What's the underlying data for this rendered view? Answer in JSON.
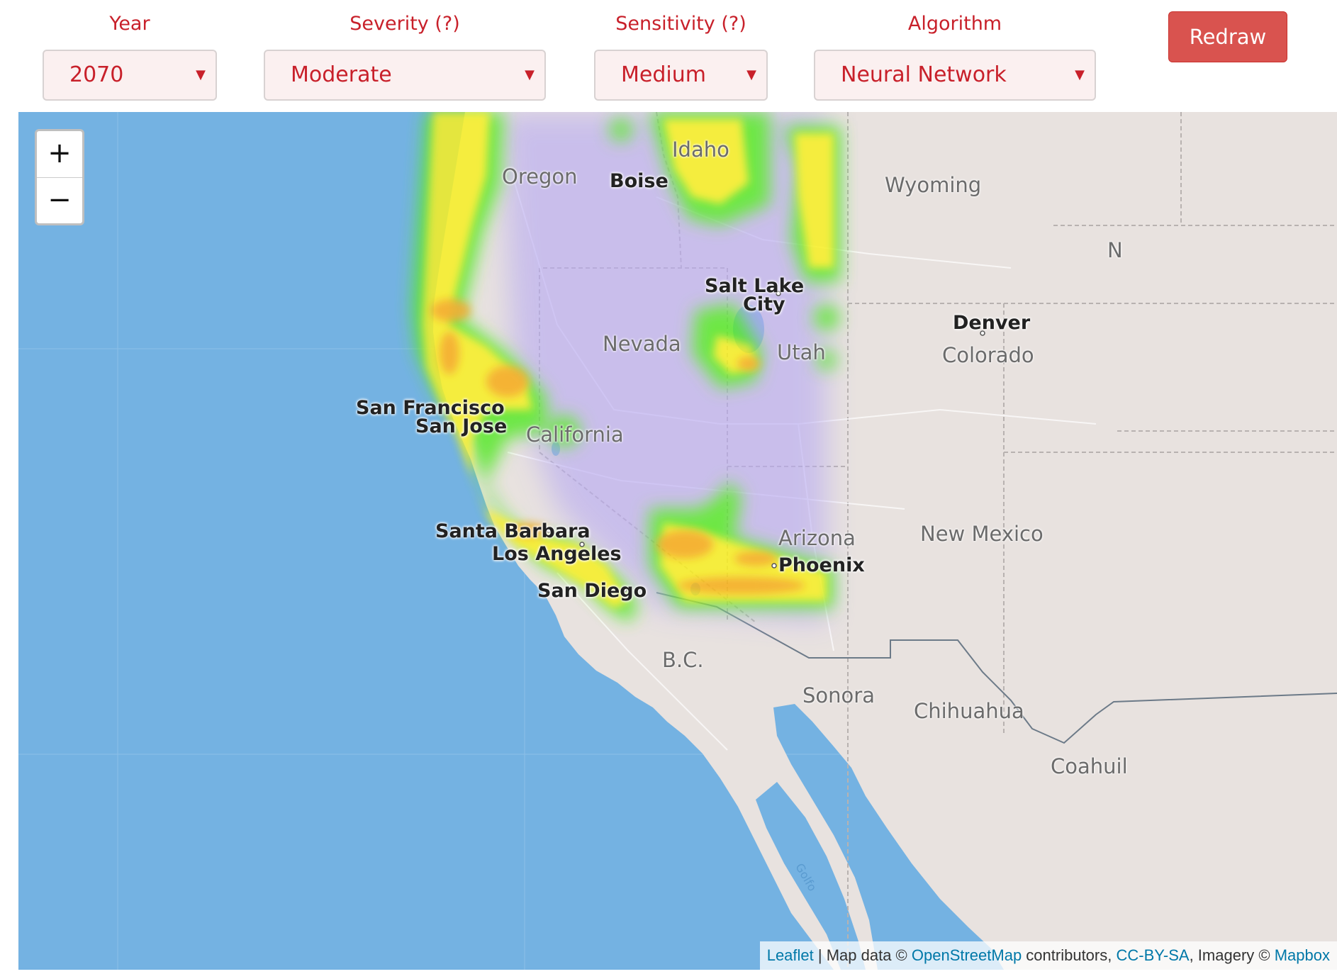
{
  "controls": {
    "year": {
      "label": "Year",
      "value": "2070"
    },
    "severity": {
      "label": "Severity (?)",
      "value": "Moderate"
    },
    "sensitivity": {
      "label": "Sensitivity (?)",
      "value": "Medium"
    },
    "algorithm": {
      "label": "Algorithm",
      "value": "Neural Network"
    },
    "redraw_label": "Redraw",
    "caret": "▼"
  },
  "map": {
    "zoom_in": "+",
    "zoom_out": "−",
    "states": {
      "oregon": "Oregon",
      "idaho": "Idaho",
      "wyoming": "Wyoming",
      "nevada": "Nevada",
      "utah": "Utah",
      "colorado": "Colorado",
      "california": "California",
      "arizona": "Arizona",
      "new_mexico": "New Mexico",
      "bc": "B.C.",
      "sonora": "Sonora",
      "chihuahua": "Chihuahua",
      "coahuila": "Coahuil",
      "edge_n": "N"
    },
    "cities": {
      "boise": "Boise",
      "salt_lake_1": "Salt Lake",
      "salt_lake_2": "City",
      "denver": "Denver",
      "san_francisco": "San Francisco",
      "san_jose": "San Jose",
      "santa_barbara": "Santa Barbara",
      "los_angeles": "Los Angeles",
      "san_diego": "San Diego",
      "phoenix": "Phoenix"
    },
    "gulf_label": "Golfo",
    "attribution": {
      "leaflet": "Leaflet",
      "sep": " | Map data © ",
      "osm": "OpenStreetMap",
      "contributors": " contributors, ",
      "ccbysa": "CC-BY-SA",
      "imagery": ", Imagery © ",
      "mapbox": "Mapbox"
    },
    "colors": {
      "ocean": "#74b2e2",
      "land": "#e8e2df",
      "heat_low": "#b8aaf2",
      "heat_green": "#58e82a",
      "heat_yellow": "#f8f020",
      "heat_orange": "#f8a018"
    }
  }
}
